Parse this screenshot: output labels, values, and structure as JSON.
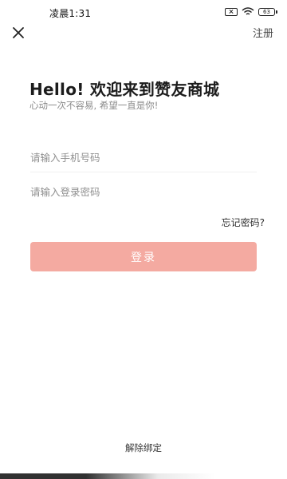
{
  "status_bar": {
    "time": "凌晨1:31",
    "battery": "63"
  },
  "nav": {
    "close_icon": "close-icon",
    "register_label": "注册"
  },
  "welcome": {
    "title": "Hello! 欢迎来到赞友商城",
    "subtitle": "心动一次不容易, 希望一直是你!"
  },
  "form": {
    "phone_placeholder": "请输入手机号码",
    "phone_value": "",
    "password_placeholder": "请输入登录密码",
    "password_value": "",
    "forgot_label": "忘记密码?",
    "login_label": "登录"
  },
  "footer": {
    "unbind_label": "解除绑定"
  },
  "colors": {
    "login_button": "#f4aaa1",
    "placeholder": "#8f8f8f"
  }
}
